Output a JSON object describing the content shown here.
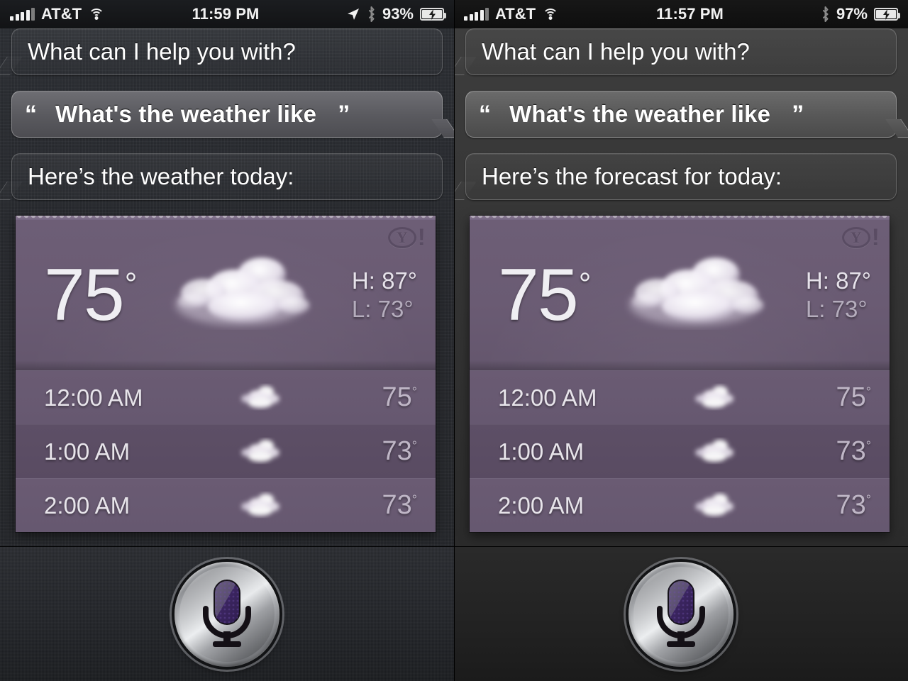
{
  "panels": [
    {
      "id": "left",
      "status_bar": {
        "signal_icon": "signal-bars-icon",
        "carrier": "AT&T",
        "wifi_icon": "wifi-icon",
        "time": "11:59 PM",
        "location_icon": "location-arrow-icon",
        "bluetooth_icon": "bluetooth-icon",
        "battery_percent": "93%",
        "battery_icon": "battery-charging-icon",
        "show_location": true
      },
      "conversation": [
        {
          "role": "siri",
          "text": "What can I help you with?"
        },
        {
          "role": "user",
          "text": "What's the weather like",
          "quote_open": "“",
          "quote_close": "”"
        },
        {
          "role": "siri",
          "text": "Here’s the weather today:"
        }
      ],
      "weather_card": {
        "provider_logo": "yahoo-logo",
        "provider_letter": "Y",
        "provider_bang": "!",
        "current_temp": "75",
        "degree": "°",
        "condition_icon": "cloudy-icon",
        "high_label": "H:",
        "high_value": "87°",
        "low_label": "L:",
        "low_value": "73°",
        "hourly": [
          {
            "time": "12:00 AM",
            "icon": "cloudy-icon",
            "temp": "75",
            "degree": "°"
          },
          {
            "time": "1:00 AM",
            "icon": "cloudy-icon",
            "temp": "73",
            "degree": "°"
          },
          {
            "time": "2:00 AM",
            "icon": "cloudy-icon",
            "temp": "73",
            "degree": "°"
          }
        ]
      },
      "toolbar": {
        "mic_button": "siri-mic-button"
      }
    },
    {
      "id": "right",
      "status_bar": {
        "signal_icon": "signal-bars-icon",
        "carrier": "AT&T",
        "wifi_icon": "wifi-icon",
        "time": "11:57 PM",
        "location_icon": "location-arrow-icon",
        "bluetooth_icon": "bluetooth-icon",
        "battery_percent": "97%",
        "battery_icon": "battery-charging-icon",
        "show_location": false
      },
      "conversation": [
        {
          "role": "siri",
          "text": "What can I help you with?"
        },
        {
          "role": "user",
          "text": "What's the weather like",
          "quote_open": "“",
          "quote_close": "”"
        },
        {
          "role": "siri",
          "text": "Here’s the forecast for today:"
        }
      ],
      "weather_card": {
        "provider_logo": "yahoo-logo",
        "provider_letter": "Y",
        "provider_bang": "!",
        "current_temp": "75",
        "degree": "°",
        "condition_icon": "cloudy-icon",
        "high_label": "H:",
        "high_value": "87°",
        "low_label": "L:",
        "low_value": "73°",
        "hourly": [
          {
            "time": "12:00 AM",
            "icon": "cloudy-icon",
            "temp": "75",
            "degree": "°"
          },
          {
            "time": "1:00 AM",
            "icon": "cloudy-icon",
            "temp": "73",
            "degree": "°"
          },
          {
            "time": "2:00 AM",
            "icon": "cloudy-icon",
            "temp": "73",
            "degree": "°"
          }
        ]
      },
      "toolbar": {
        "mic_button": "siri-mic-button"
      }
    }
  ],
  "colors": {
    "card_purple": "#6a5b73",
    "card_purple_dark": "#5d4f66",
    "bubble_user": "#5a5a5f",
    "text_primary": "#ffffff",
    "text_muted": "#bfb6c6",
    "left_bg": "#26282d",
    "right_bg": "#343434"
  }
}
